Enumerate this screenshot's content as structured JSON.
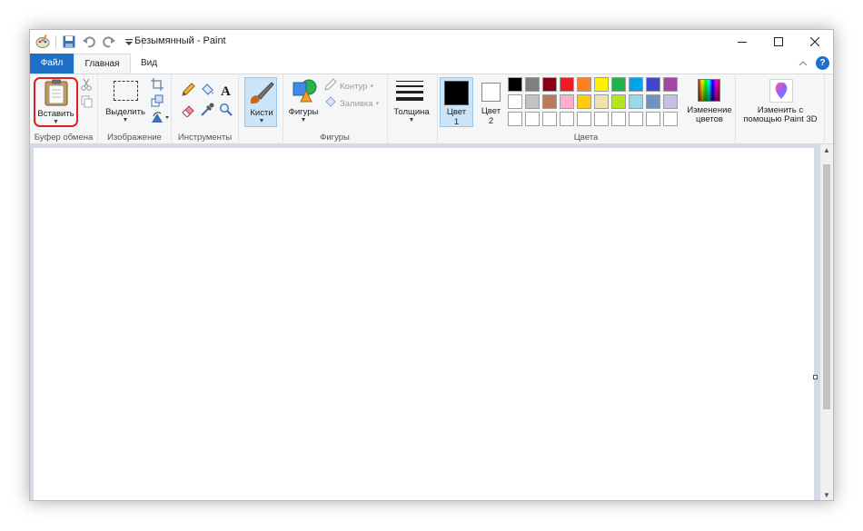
{
  "window": {
    "title": "Безымянный - Paint"
  },
  "quick_access": {
    "icons": [
      "paint-app-icon",
      "save-icon",
      "undo-icon",
      "redo-icon",
      "customize-qat-icon"
    ]
  },
  "tabs": [
    {
      "label": "Файл"
    },
    {
      "label": "Главная"
    },
    {
      "label": "Вид"
    }
  ],
  "ribbon": {
    "clipboard": {
      "paste_label": "Вставить",
      "group_label": "Буфер обмена"
    },
    "image": {
      "select_label": "Выделить",
      "group_label": "Изображение"
    },
    "tools": {
      "group_label": "Инструменты"
    },
    "brushes": {
      "label": "Кисти"
    },
    "shapes": {
      "label": "Фигуры",
      "outline_label": "Контур",
      "fill_label": "Заливка",
      "group_label": "Фигуры"
    },
    "size": {
      "label": "Толщина"
    },
    "colors": {
      "color1_label": "Цвет",
      "color1_num": "1",
      "color2_label": "Цвет",
      "color2_num": "2",
      "edit_label_1": "Изменение",
      "edit_label_2": "цветов",
      "group_label": "Цвета",
      "color1_value": "#000000",
      "color2_value": "#ffffff",
      "palette_row1": [
        "#000000",
        "#7f7f7f",
        "#880015",
        "#ed1c24",
        "#ff7f27",
        "#fff200",
        "#22b14c",
        "#00a2e8",
        "#3f48cc",
        "#a349a4"
      ],
      "palette_row2": [
        "#ffffff",
        "#c3c3c3",
        "#b97a57",
        "#ffaec9",
        "#ffc90e",
        "#efe4b0",
        "#b5e61d",
        "#99d9ea",
        "#7092be",
        "#c8bfe7"
      ],
      "palette_row3": [
        "#ffffff",
        "#ffffff",
        "#ffffff",
        "#ffffff",
        "#ffffff",
        "#ffffff",
        "#ffffff",
        "#ffffff",
        "#ffffff",
        "#ffffff"
      ]
    },
    "paint3d": {
      "label_1": "Изменить с",
      "label_2": "помощью Paint 3D"
    }
  },
  "accent_color": "#1e6fc7",
  "highlight_color": "#e02020"
}
